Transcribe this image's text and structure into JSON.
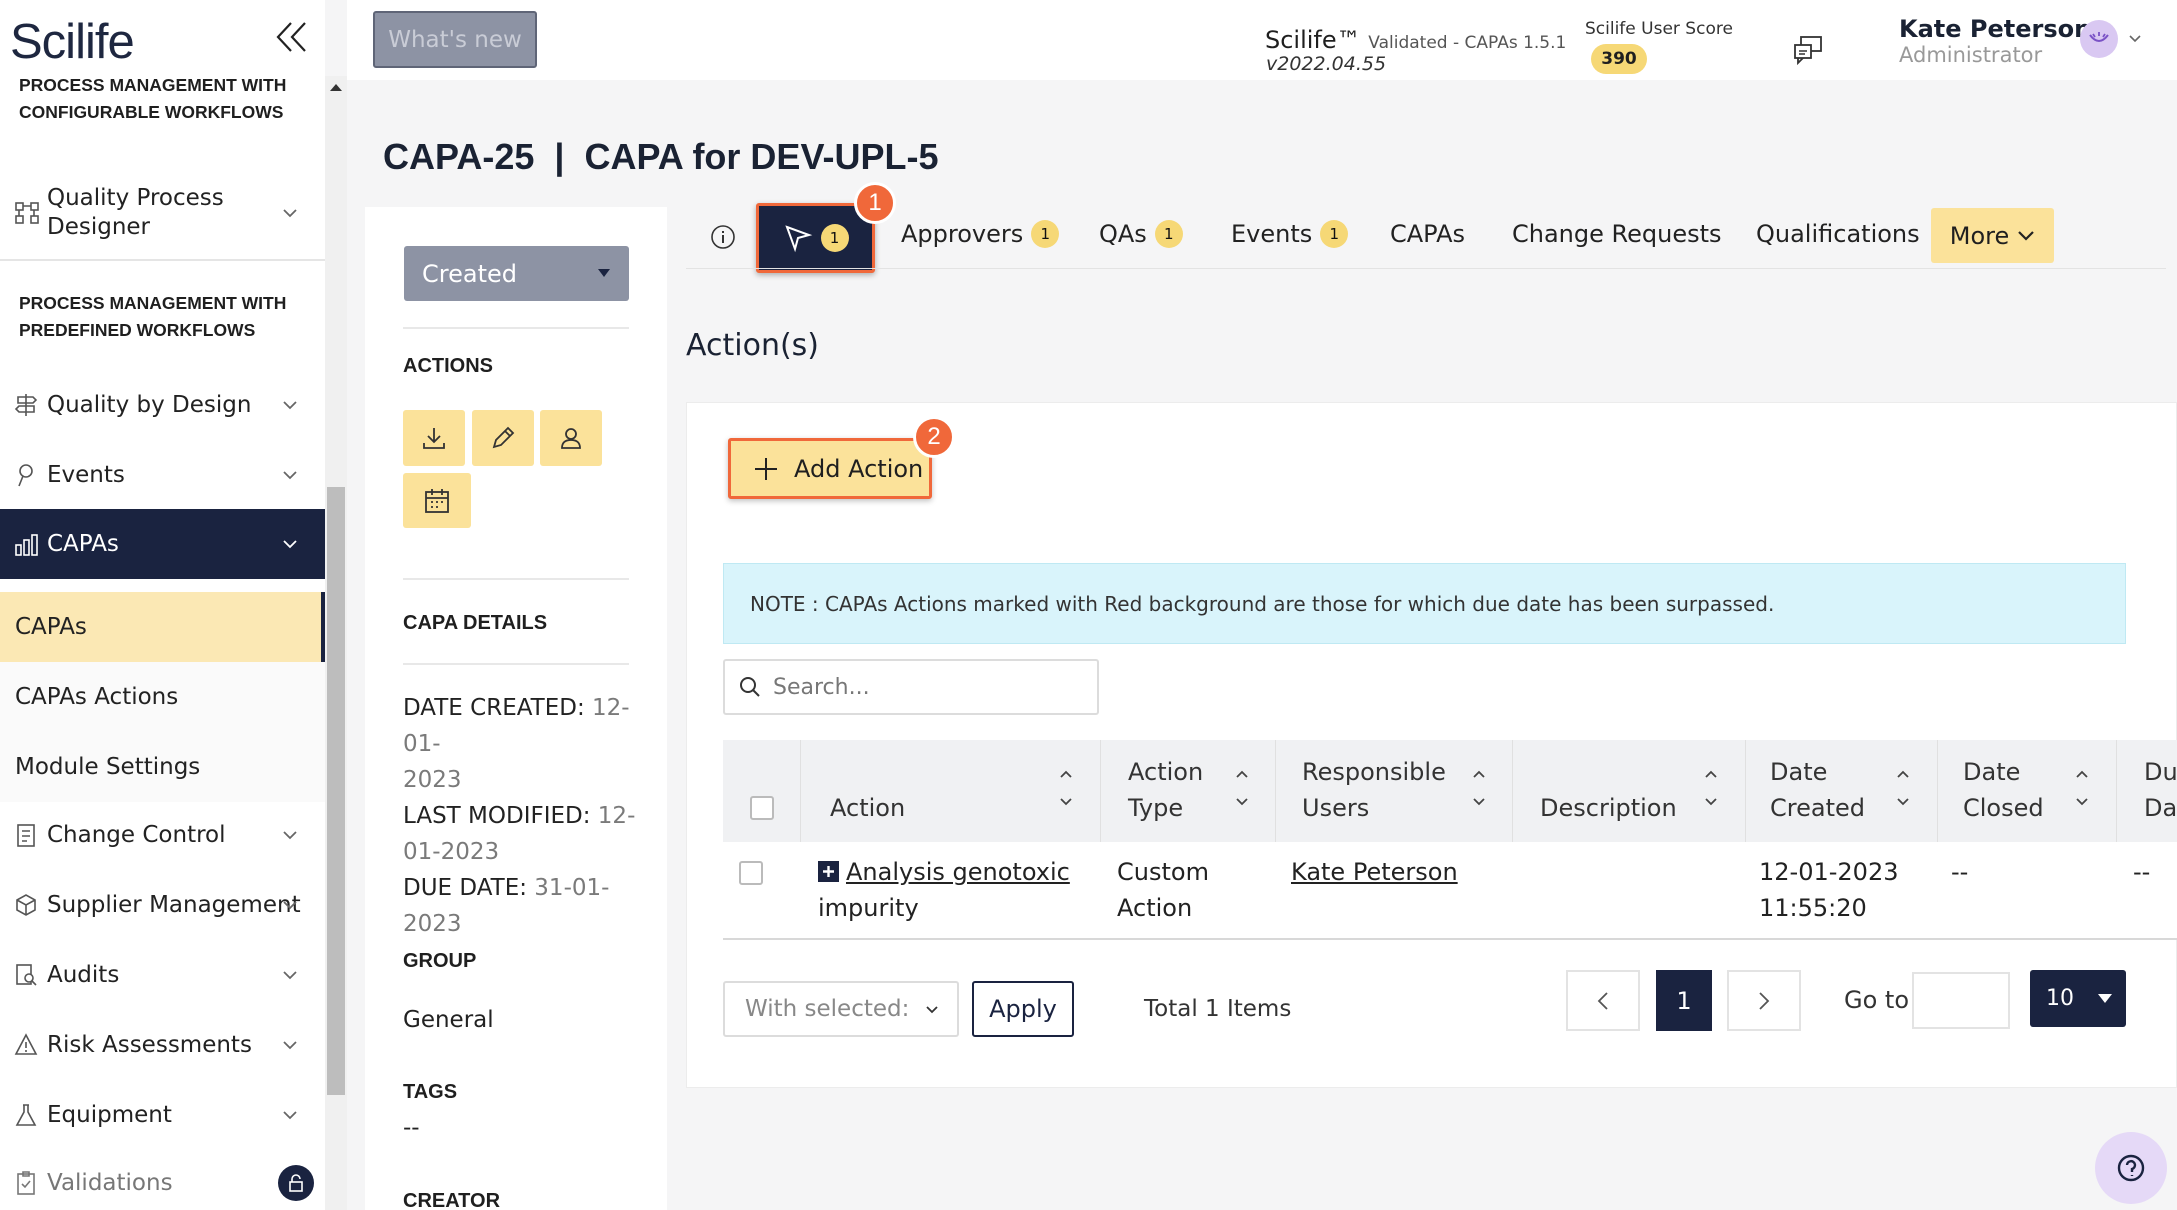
{
  "app": {
    "logo": "Scilife"
  },
  "header": {
    "whats_new": "What's new",
    "product": "Scilife™",
    "validated": "Validated - CAPAs 1.5.1",
    "version": "v2022.04.55",
    "score_label": "Scilife User Score",
    "score_value": "390",
    "user_name": "Kate Peterson",
    "user_role": "Administrator"
  },
  "sidebar": {
    "section1": "PROCESS MANAGEMENT WITH\nCONFIGURABLE WORKFLOWS",
    "qpd_line1": "Quality Process",
    "qpd_line2": "Designer",
    "section2": "PROCESS MANAGEMENT WITH\nPREDEFINED WORKFLOWS",
    "items": [
      {
        "label": "Quality by Design"
      },
      {
        "label": "Events"
      },
      {
        "label": "CAPAs"
      },
      {
        "label": "Change Control"
      },
      {
        "label": "Supplier Management"
      },
      {
        "label": "Audits"
      },
      {
        "label": "Risk Assessments"
      },
      {
        "label": "Equipment"
      },
      {
        "label": "Validations"
      }
    ],
    "sub_items": [
      {
        "label": "CAPAs"
      },
      {
        "label": "CAPAs Actions"
      },
      {
        "label": "Module Settings"
      }
    ]
  },
  "page": {
    "title": "CAPA-25  |  CAPA for DEV-UPL-5"
  },
  "left_panel": {
    "status": "Created",
    "actions_heading": "ACTIONS",
    "details_heading": "CAPA DETAILS",
    "date_created_label": "DATE CREATED:",
    "date_created_value": "12-01-",
    "date_created_value2": "2023",
    "last_modified_label": "LAST MODIFIED:",
    "last_modified_value": "12-",
    "last_modified_value2": "01-2023",
    "due_date_label": "DUE DATE:",
    "due_date_value": "31-01-",
    "due_date_value2": "2023",
    "group_heading": "GROUP",
    "group_value": "General",
    "tags_heading": "TAGS",
    "tags_value": "--",
    "creator_heading": "CREATOR"
  },
  "tabs": [
    {
      "label": "",
      "badge": "1"
    },
    {
      "label": "Approvers",
      "badge": "1"
    },
    {
      "label": "QAs",
      "badge": "1"
    },
    {
      "label": "Events",
      "badge": "1"
    },
    {
      "label": "CAPAs"
    },
    {
      "label": "Change Requests"
    },
    {
      "label": "Qualifications"
    },
    {
      "label": "More"
    }
  ],
  "callouts": {
    "one": "1",
    "two": "2"
  },
  "main": {
    "section_title": "Action(s)",
    "add_action": "Add Action",
    "note": "NOTE : CAPAs Actions marked with Red background are those for which due date has been surpassed.",
    "search_placeholder": "Search...",
    "columns": {
      "action": "Action",
      "action_type1": "Action",
      "action_type2": "Type",
      "responsible1": "Responsible",
      "responsible2": "Users",
      "description": "Description",
      "date_created1": "Date",
      "date_created2": "Created",
      "date_closed1": "Date",
      "date_closed2": "Closed",
      "due1": "Due",
      "due2": "Date"
    },
    "rows": [
      {
        "action1": "Analysis genotoxic",
        "action2": "impurity",
        "type1": "Custom",
        "type2": "Action",
        "responsible": "Kate Peterson",
        "description": "",
        "created1": "12-01-2023",
        "created2": "11:55:20",
        "closed": "--",
        "due": "--"
      }
    ],
    "with_selected": "With selected:",
    "apply": "Apply",
    "total": "Total 1 Items",
    "page": "1",
    "goto": "Go to",
    "page_size": "10"
  },
  "colors": {
    "navy": "#1a2340",
    "accent_yellow": "#fbe29a",
    "callout": "#f0683a",
    "note_bg": "#d9f4fb"
  }
}
